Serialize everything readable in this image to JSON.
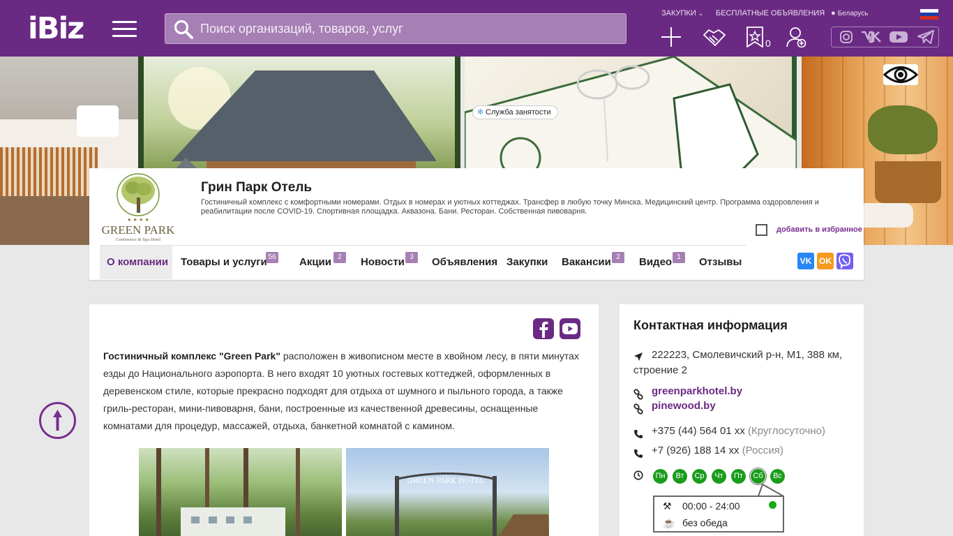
{
  "header": {
    "logo": "iBiz",
    "search_placeholder": "Поиск организаций, товаров, услуг",
    "purchases_label": "ЗАКУПКИ",
    "free_ads_label": "БЕСПЛАТНЫЕ ОБЪЯВЛЕНИЯ",
    "region_label": "Беларусь",
    "favorites_count": "0",
    "brand_color": "#6a2a83"
  },
  "company": {
    "name": "Грин Парк Отель",
    "description": "Гостиничный комплекс с комфортными номерами. Отдых в номерах и уютных коттеджах. Трансфер в любую точку Минска. Медицинский центр. Программа оздоровления и реабилитации после COVID-19. Спортивная площадка. Аквазона. Бани. Ресторан. Собственная пивоварня.",
    "add_to_favorites": "добавить в избранное",
    "logo_name": "GREEN PARK",
    "logo_subtitle": "Conference & Spa Hotel"
  },
  "tabs": [
    {
      "label": "О компании",
      "badge": ""
    },
    {
      "label": "Товары и услуги",
      "badge": "56"
    },
    {
      "label": "Акции",
      "badge": "2"
    },
    {
      "label": "Новости",
      "badge": "3"
    },
    {
      "label": "Объявления",
      "badge": ""
    },
    {
      "label": "Закупки",
      "badge": ""
    },
    {
      "label": "Вакансии",
      "badge": "2"
    },
    {
      "label": "Видео",
      "badge": "1"
    },
    {
      "label": "Отзывы",
      "badge": ""
    }
  ],
  "employment_service": "Служба занятости",
  "share": {
    "vk": "VK",
    "ok": "OK",
    "viber": "Viber"
  },
  "about": {
    "intro_bold": "Гостиничный комплекс \"Green Park\"",
    "text": " расположен в живописном месте в хвойном лесу, в пяти минутах езды до Национального аэропорта.  В него входят 10 уютных  гостевых коттеджей, оформленных в деревенском стиле, которые прекрасно подходят для отдыха от шумного и пыльного города, а также гриль-ресторан, мини-пивоварня, бани, построенные из качественной древесины, оснащенные комнатами для процедур, массажей, отдыха, банкетной комнатой с камином.",
    "gate_sign": "GREEN PARK HOTEL"
  },
  "contacts": {
    "title": "Контактная информация",
    "address": "222223, Смолевичский р-н, М1, 388 км, строение 2",
    "sites": [
      "greenparkhotel.by",
      "pinewood.by"
    ],
    "phones": [
      {
        "number": "+375 (44) 564 01 xx",
        "note": "(Круглосуточно)"
      },
      {
        "number": "+7 (926) 188 14 xx",
        "note": "(Россия)"
      }
    ],
    "days": [
      "Пн",
      "Вт",
      "Ср",
      "Чт",
      "Пт",
      "Сб",
      "Вс"
    ],
    "selected_day": "Сб",
    "hours": "00:00 - 24:00",
    "lunch": "без обеда",
    "open_color": "#18a818"
  }
}
